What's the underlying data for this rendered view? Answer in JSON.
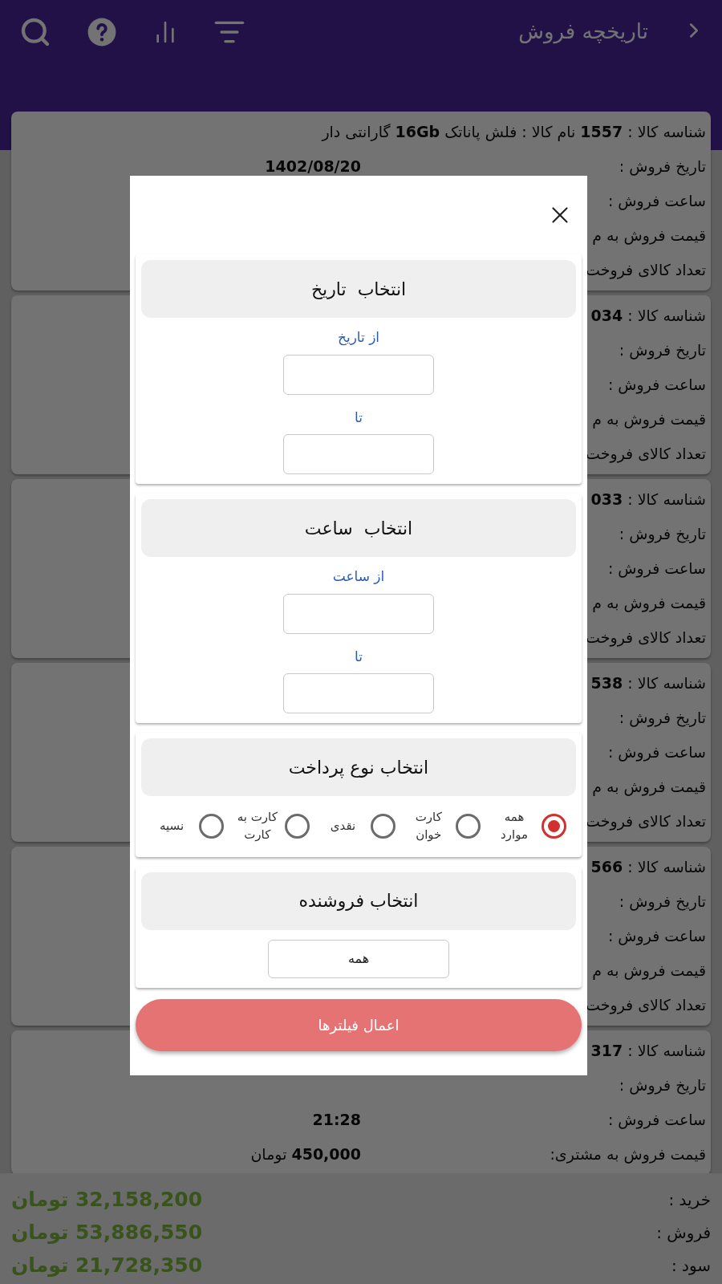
{
  "header": {
    "title": "تاریخچه فروش"
  },
  "sales": [
    {
      "id_line": "شناسه کالا : **1557** نام کالا : فلش پاناتک **16Gb** گارانتی دار",
      "rows": [
        {
          "label": "تاریخ فروش :",
          "value": "**1402/08/20**"
        },
        {
          "label": "ساعت فروش :"
        },
        {
          "label": "قیمت فروش به م"
        },
        {
          "label": "تعداد کالای فروخت"
        }
      ]
    },
    {
      "id_line": "شناسه کالا : **034**",
      "rows": [
        {
          "label": "تاریخ فروش :"
        },
        {
          "label": "ساعت فروش :"
        },
        {
          "label": "قیمت فروش به م"
        },
        {
          "label": "تعداد کالای فروخت"
        }
      ]
    },
    {
      "id_line": "شناسه کالا : **033**",
      "rows": [
        {
          "label": "تاریخ فروش :"
        },
        {
          "label": "ساعت فروش :"
        },
        {
          "label": "قیمت فروش به م"
        },
        {
          "label": "تعداد کالای فروخت"
        }
      ]
    },
    {
      "id_line": "شناسه کالا : **538**",
      "rows": [
        {
          "label": "تاریخ فروش :"
        },
        {
          "label": "ساعت فروش :"
        },
        {
          "label": "قیمت فروش به م"
        },
        {
          "label": "تعداد کالای فروخت"
        }
      ]
    },
    {
      "id_line": "شناسه کالا : **566**",
      "rows": [
        {
          "label": "تاریخ فروش :"
        },
        {
          "label": "ساعت فروش :"
        },
        {
          "label": "قیمت فروش به م"
        },
        {
          "label": "تعداد کالای فروخت"
        }
      ]
    },
    {
      "id_line": "شناسه کالا : **317**",
      "rows": [
        {
          "label": "تاریخ فروش :"
        },
        {
          "label": "ساعت فروش :",
          "value": "**21:28**"
        },
        {
          "label": "قیمت فروش به مشتری:",
          "value": "**450,000** تومان"
        }
      ]
    }
  ],
  "totals": [
    {
      "label": "خرید :",
      "value": "32,158,200 تومان"
    },
    {
      "label": "فروش :",
      "value": "53,886,550 تومان"
    },
    {
      "label": "سود :",
      "value": "21,728,350 تومان"
    }
  ],
  "filter_dialog": {
    "sections": [
      {
        "kind": "range",
        "title": "انتخاب  تاریخ",
        "from_label": "از تاریخ",
        "to_label": "تا"
      },
      {
        "kind": "range",
        "title": "انتخاب  ساعت",
        "from_label": "از ساعت",
        "to_label": "تا"
      },
      {
        "kind": "radio",
        "title": "انتخاب نوع پرداخت",
        "options": [
          {
            "label": "همه موارد",
            "selected": true
          },
          {
            "label": "کارت خوان",
            "selected": false
          },
          {
            "label": "نقدی",
            "selected": false
          },
          {
            "label": "کارت به کارت",
            "selected": false
          },
          {
            "label": "نسیه",
            "selected": false
          }
        ]
      },
      {
        "kind": "select",
        "title": "انتخاب فروشنده",
        "value": "همه"
      }
    ],
    "apply_button": "اعمال فیلترها"
  }
}
